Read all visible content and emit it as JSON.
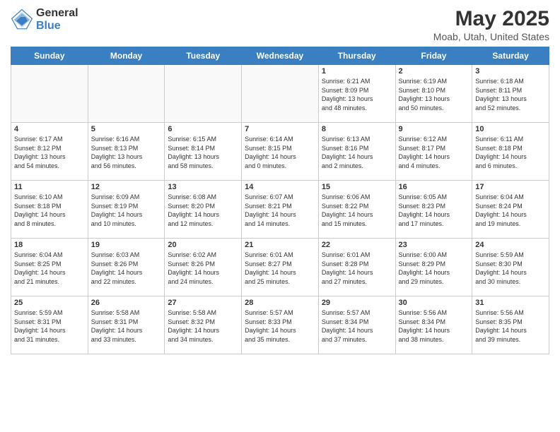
{
  "header": {
    "logo_general": "General",
    "logo_blue": "Blue",
    "month_year": "May 2025",
    "location": "Moab, Utah, United States"
  },
  "weekdays": [
    "Sunday",
    "Monday",
    "Tuesday",
    "Wednesday",
    "Thursday",
    "Friday",
    "Saturday"
  ],
  "weeks": [
    [
      {
        "day": "",
        "info": ""
      },
      {
        "day": "",
        "info": ""
      },
      {
        "day": "",
        "info": ""
      },
      {
        "day": "",
        "info": ""
      },
      {
        "day": "1",
        "info": "Sunrise: 6:21 AM\nSunset: 8:09 PM\nDaylight: 13 hours\nand 48 minutes."
      },
      {
        "day": "2",
        "info": "Sunrise: 6:19 AM\nSunset: 8:10 PM\nDaylight: 13 hours\nand 50 minutes."
      },
      {
        "day": "3",
        "info": "Sunrise: 6:18 AM\nSunset: 8:11 PM\nDaylight: 13 hours\nand 52 minutes."
      }
    ],
    [
      {
        "day": "4",
        "info": "Sunrise: 6:17 AM\nSunset: 8:12 PM\nDaylight: 13 hours\nand 54 minutes."
      },
      {
        "day": "5",
        "info": "Sunrise: 6:16 AM\nSunset: 8:13 PM\nDaylight: 13 hours\nand 56 minutes."
      },
      {
        "day": "6",
        "info": "Sunrise: 6:15 AM\nSunset: 8:14 PM\nDaylight: 13 hours\nand 58 minutes."
      },
      {
        "day": "7",
        "info": "Sunrise: 6:14 AM\nSunset: 8:15 PM\nDaylight: 14 hours\nand 0 minutes."
      },
      {
        "day": "8",
        "info": "Sunrise: 6:13 AM\nSunset: 8:16 PM\nDaylight: 14 hours\nand 2 minutes."
      },
      {
        "day": "9",
        "info": "Sunrise: 6:12 AM\nSunset: 8:17 PM\nDaylight: 14 hours\nand 4 minutes."
      },
      {
        "day": "10",
        "info": "Sunrise: 6:11 AM\nSunset: 8:18 PM\nDaylight: 14 hours\nand 6 minutes."
      }
    ],
    [
      {
        "day": "11",
        "info": "Sunrise: 6:10 AM\nSunset: 8:18 PM\nDaylight: 14 hours\nand 8 minutes."
      },
      {
        "day": "12",
        "info": "Sunrise: 6:09 AM\nSunset: 8:19 PM\nDaylight: 14 hours\nand 10 minutes."
      },
      {
        "day": "13",
        "info": "Sunrise: 6:08 AM\nSunset: 8:20 PM\nDaylight: 14 hours\nand 12 minutes."
      },
      {
        "day": "14",
        "info": "Sunrise: 6:07 AM\nSunset: 8:21 PM\nDaylight: 14 hours\nand 14 minutes."
      },
      {
        "day": "15",
        "info": "Sunrise: 6:06 AM\nSunset: 8:22 PM\nDaylight: 14 hours\nand 15 minutes."
      },
      {
        "day": "16",
        "info": "Sunrise: 6:05 AM\nSunset: 8:23 PM\nDaylight: 14 hours\nand 17 minutes."
      },
      {
        "day": "17",
        "info": "Sunrise: 6:04 AM\nSunset: 8:24 PM\nDaylight: 14 hours\nand 19 minutes."
      }
    ],
    [
      {
        "day": "18",
        "info": "Sunrise: 6:04 AM\nSunset: 8:25 PM\nDaylight: 14 hours\nand 21 minutes."
      },
      {
        "day": "19",
        "info": "Sunrise: 6:03 AM\nSunset: 8:26 PM\nDaylight: 14 hours\nand 22 minutes."
      },
      {
        "day": "20",
        "info": "Sunrise: 6:02 AM\nSunset: 8:26 PM\nDaylight: 14 hours\nand 24 minutes."
      },
      {
        "day": "21",
        "info": "Sunrise: 6:01 AM\nSunset: 8:27 PM\nDaylight: 14 hours\nand 25 minutes."
      },
      {
        "day": "22",
        "info": "Sunrise: 6:01 AM\nSunset: 8:28 PM\nDaylight: 14 hours\nand 27 minutes."
      },
      {
        "day": "23",
        "info": "Sunrise: 6:00 AM\nSunset: 8:29 PM\nDaylight: 14 hours\nand 29 minutes."
      },
      {
        "day": "24",
        "info": "Sunrise: 5:59 AM\nSunset: 8:30 PM\nDaylight: 14 hours\nand 30 minutes."
      }
    ],
    [
      {
        "day": "25",
        "info": "Sunrise: 5:59 AM\nSunset: 8:31 PM\nDaylight: 14 hours\nand 31 minutes."
      },
      {
        "day": "26",
        "info": "Sunrise: 5:58 AM\nSunset: 8:31 PM\nDaylight: 14 hours\nand 33 minutes."
      },
      {
        "day": "27",
        "info": "Sunrise: 5:58 AM\nSunset: 8:32 PM\nDaylight: 14 hours\nand 34 minutes."
      },
      {
        "day": "28",
        "info": "Sunrise: 5:57 AM\nSunset: 8:33 PM\nDaylight: 14 hours\nand 35 minutes."
      },
      {
        "day": "29",
        "info": "Sunrise: 5:57 AM\nSunset: 8:34 PM\nDaylight: 14 hours\nand 37 minutes."
      },
      {
        "day": "30",
        "info": "Sunrise: 5:56 AM\nSunset: 8:34 PM\nDaylight: 14 hours\nand 38 minutes."
      },
      {
        "day": "31",
        "info": "Sunrise: 5:56 AM\nSunset: 8:35 PM\nDaylight: 14 hours\nand 39 minutes."
      }
    ]
  ]
}
